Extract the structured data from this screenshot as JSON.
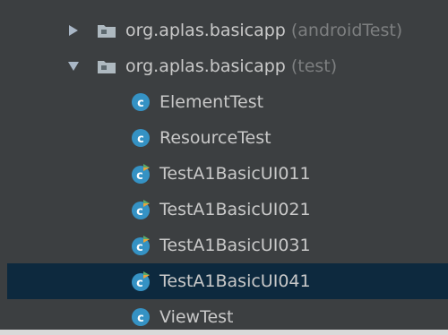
{
  "tree": {
    "packages": [
      {
        "name": "org.aplas.basicapp",
        "qualifier": "(androidTest)",
        "expanded": false
      },
      {
        "name": "org.aplas.basicapp",
        "qualifier": "(test)",
        "expanded": true
      }
    ],
    "classes": [
      {
        "label": "ElementTest",
        "icon": "class-icon",
        "runnable": false,
        "selected": false
      },
      {
        "label": "ResourceTest",
        "icon": "class-icon",
        "runnable": false,
        "selected": false
      },
      {
        "label": "TestA1BasicUI011",
        "icon": "test-class-icon",
        "runnable": true,
        "selected": false
      },
      {
        "label": "TestA1BasicUI021",
        "icon": "test-class-icon",
        "runnable": true,
        "selected": false
      },
      {
        "label": "TestA1BasicUI031",
        "icon": "test-class-icon",
        "runnable": true,
        "selected": false
      },
      {
        "label": "TestA1BasicUI041",
        "icon": "test-class-icon",
        "runnable": true,
        "selected": true
      },
      {
        "label": "ViewTest",
        "icon": "class-icon",
        "runnable": false,
        "selected": false
      }
    ]
  },
  "colors": {
    "background": "#3c3f41",
    "selection": "#0d293e",
    "text": "#bbbbbb",
    "muted": "#7d7f80",
    "class_icon": "#3592c4",
    "run_arrow_green": "#59a869",
    "run_arrow_orange": "#e8a33d"
  }
}
